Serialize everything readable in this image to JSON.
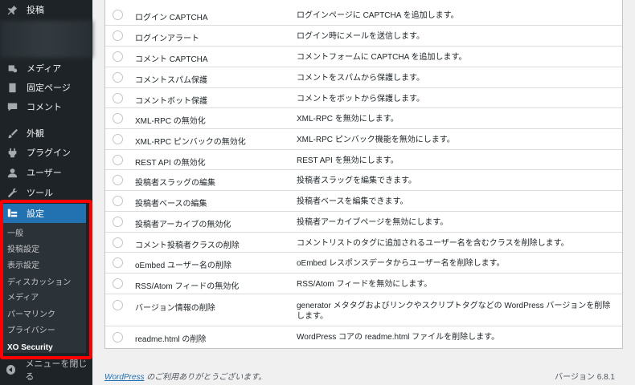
{
  "sidebar": {
    "top_item": "投稿",
    "items": [
      {
        "label": "メディア",
        "icon": "media-icon"
      },
      {
        "label": "固定ページ",
        "icon": "page-icon"
      },
      {
        "label": "コメント",
        "icon": "comment-icon"
      },
      {
        "label": "外観",
        "icon": "appearance-icon"
      },
      {
        "label": "プラグイン",
        "icon": "plugin-icon"
      },
      {
        "label": "ユーザー",
        "icon": "user-icon"
      },
      {
        "label": "ツール",
        "icon": "tools-icon"
      }
    ],
    "settings_label": "設定",
    "submenu": [
      "一般",
      "投稿設定",
      "表示設定",
      "ディスカッション",
      "メディア",
      "パーマリンク",
      "プライバシー",
      "XO Security"
    ],
    "collapse_label": "メニューを閉じる",
    "accent_color": "#2271b1",
    "highlight_color": "#ff0000"
  },
  "table": {
    "rows": [
      {
        "name": "ログイン CAPTCHA",
        "desc": "ログインページに CAPTCHA を追加します。"
      },
      {
        "name": "ログインアラート",
        "desc": "ログイン時にメールを送信します。"
      },
      {
        "name": "コメント CAPTCHA",
        "desc": "コメントフォームに CAPTCHA を追加します。"
      },
      {
        "name": "コメントスパム保護",
        "desc": "コメントをスパムから保護します。"
      },
      {
        "name": "コメントボット保護",
        "desc": "コメントをボットから保護します。"
      },
      {
        "name": "XML-RPC の無効化",
        "desc": "XML-RPC を無効にします。"
      },
      {
        "name": "XML-RPC ピンバックの無効化",
        "desc": "XML-RPC ピンバック機能を無効にします。"
      },
      {
        "name": "REST API の無効化",
        "desc": "REST API を無効にします。"
      },
      {
        "name": "投稿者スラッグの編集",
        "desc": "投稿者スラッグを編集できます。"
      },
      {
        "name": "投稿者ベースの編集",
        "desc": "投稿者ベースを編集できます。"
      },
      {
        "name": "投稿者アーカイブの無効化",
        "desc": "投稿者アーカイブページを無効にします。"
      },
      {
        "name": "コメント投稿者クラスの削除",
        "desc": "コメントリストのタグに追加されるユーザー名を含むクラスを削除します。"
      },
      {
        "name": "oEmbed ユーザー名の削除",
        "desc": "oEmbed レスポンスデータからユーザー名を削除します。"
      },
      {
        "name": "RSS/Atom フィードの無効化",
        "desc": "RSS/Atom フィードを無効にします。"
      },
      {
        "name": "バージョン情報の削除",
        "desc": "generator メタタグおよびリンクやスクリプトタグなどの WordPress バージョンを削除します。"
      },
      {
        "name": "readme.html の削除",
        "desc": "WordPress コアの readme.html ファイルを削除します。"
      }
    ]
  },
  "footer": {
    "link_text": "WordPress",
    "thanks_text": " のご利用ありがとうございます。",
    "version": "バージョン 6.8.1"
  }
}
